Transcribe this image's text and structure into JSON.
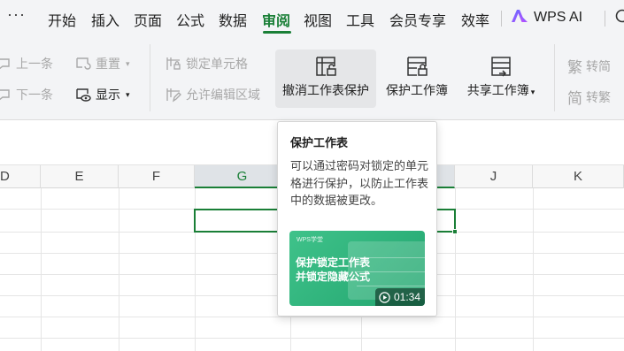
{
  "menu": {
    "more": "···",
    "items": [
      "开始",
      "插入",
      "页面",
      "公式",
      "数据",
      "审阅",
      "视图",
      "工具",
      "会员专享",
      "效率"
    ],
    "active": "审阅",
    "ai_label": "WPS AI"
  },
  "ribbon": {
    "prev_item": "上一条",
    "next_item": "下一条",
    "reset": "重置",
    "show": "显示",
    "lock_cell": "锁定单元格",
    "allow_edit_area": "允许编辑区域",
    "unprotect_sheet": "撤消工作表保护",
    "protect_workbook": "保护工作簿",
    "share_workbook": "共享工作簿",
    "to_simplified": "转简",
    "to_traditional": "转繁",
    "trad_glyph": "繁",
    "simp_glyph": "简"
  },
  "sheet": {
    "columns": [
      "D",
      "E",
      "F",
      "G",
      "",
      "J",
      "K"
    ],
    "selected_column": "G"
  },
  "tooltip": {
    "title": "保护工作表",
    "description": "可以通过密码对锁定的单元格进行保护，以防止工作表中的数据被更改。",
    "video_brand": "WPS学堂",
    "video_line1": "保护锁定工作表",
    "video_line2": "并锁定隐藏公式",
    "video_duration": "01:34"
  },
  "colors": {
    "accent": "#1a7f37",
    "ribbon_bg": "#f3f4f6",
    "video_green": "#2cb37a"
  }
}
